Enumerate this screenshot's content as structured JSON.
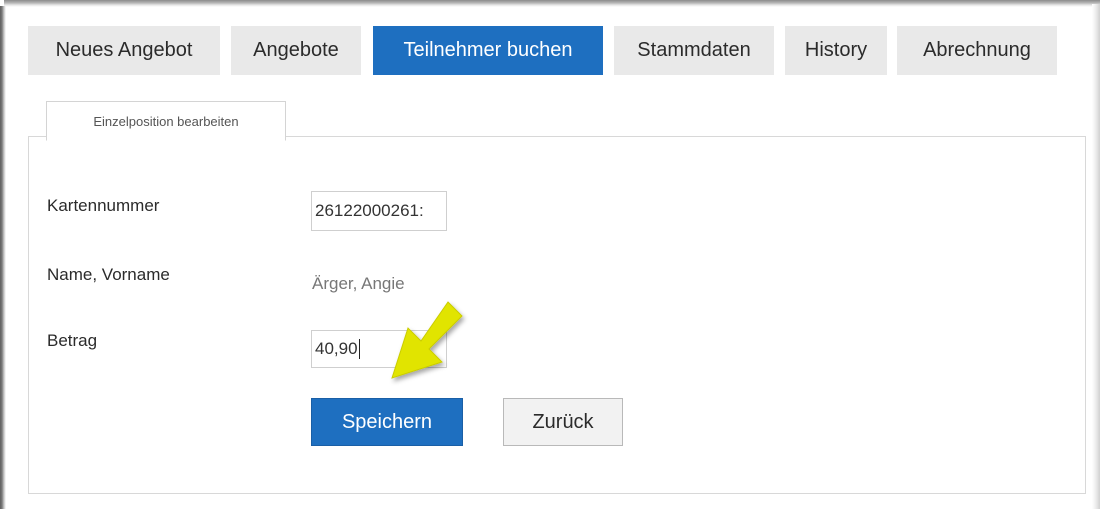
{
  "nav": {
    "tabs": [
      {
        "label": "Neues Angebot",
        "active": false
      },
      {
        "label": "Angebote",
        "active": false
      },
      {
        "label": "Teilnehmer buchen",
        "active": true
      },
      {
        "label": "Stammdaten",
        "active": false
      },
      {
        "label": "History",
        "active": false
      },
      {
        "label": "Abrechnung",
        "active": false
      }
    ]
  },
  "subtab": {
    "label": "Einzelposition bearbeiten"
  },
  "form": {
    "card_number_label": "Kartennummer",
    "card_number_value": "26122000261:",
    "name_label": "Name, Vorname",
    "name_value": "Ärger, Angie",
    "amount_label": "Betrag",
    "amount_value": "40,90"
  },
  "actions": {
    "save_label": "Speichern",
    "back_label": "Zurück"
  },
  "colors": {
    "accent": "#1e6fc0",
    "tab_inactive": "#e9e9e9",
    "annotation_arrow": "#e1e400"
  },
  "annotation": {
    "icon": "pointer-arrow-icon"
  }
}
